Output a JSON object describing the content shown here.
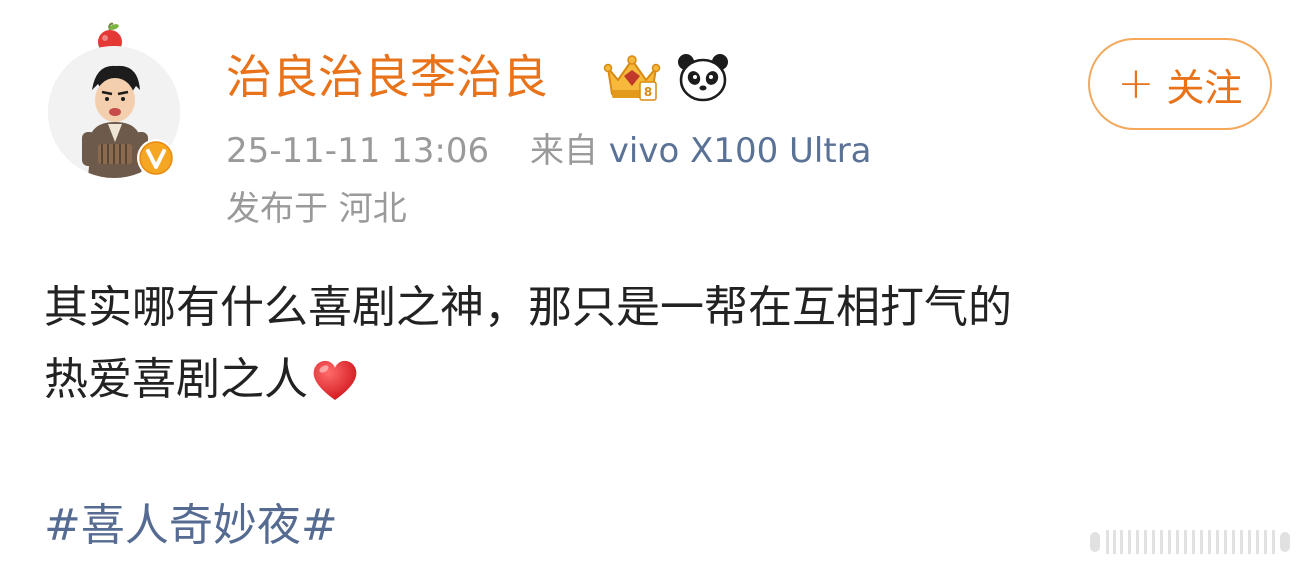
{
  "post": {
    "author": {
      "name": "治良治良李治良",
      "avatar_icon": "avatar-cartoon-man",
      "verify_icon": "verified-v-badge",
      "badges": [
        "crown-badge-icon",
        "panda-icon"
      ]
    },
    "follow_label": "关注",
    "follow_icon": "plus",
    "time": "25-11-11 13:06",
    "source_prefix": "来自",
    "device": "vivo X100 Ultra",
    "location": "发布于 河北",
    "content_line1": "其实哪有什么喜剧之神，那只是一帮在互相打气的",
    "content_line2": "热爱喜剧之人",
    "content_emoji": "red-heart-icon",
    "hashtag": "#喜人奇妙夜#"
  },
  "colors": {
    "username": "#e8731a",
    "follow_border": "#f3a85c",
    "meta_gray": "#9a9a9a",
    "device_blue": "#5b7297",
    "hashtag_blue": "#566b91",
    "text": "#222222",
    "heart": "#e5262b"
  }
}
